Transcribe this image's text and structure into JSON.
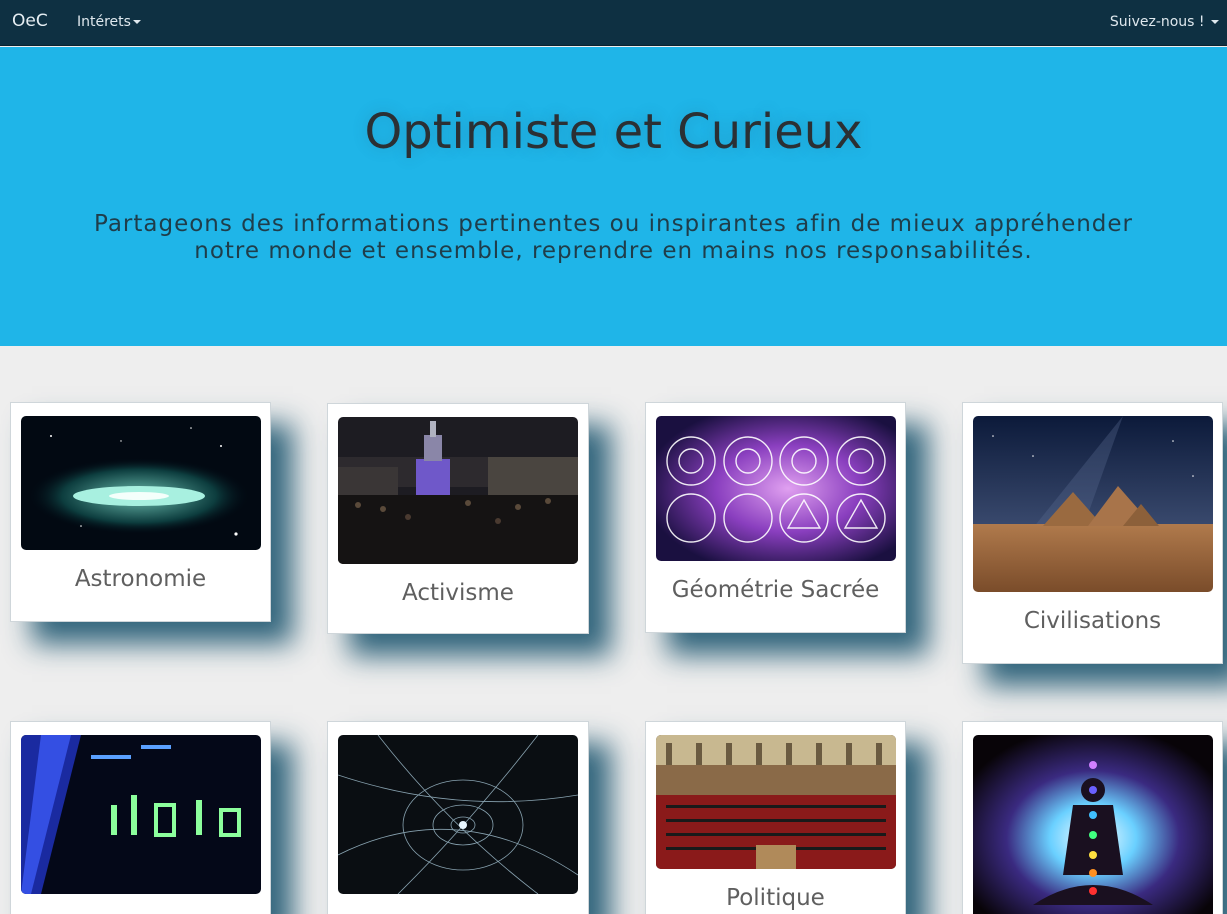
{
  "navbar": {
    "brand": "OeC",
    "menu_interests": "Intérets",
    "menu_follow": "Suivez-nous !"
  },
  "hero": {
    "title": "Optimiste et Curieux",
    "subtitle": "Partageons des informations pertinentes ou inspirantes afin de mieux appréhender notre monde et ensemble, reprendre en mains nos responsabilités."
  },
  "cards": [
    {
      "label": "Astronomie",
      "image": "galaxy"
    },
    {
      "label": "Activisme",
      "image": "night-crowd"
    },
    {
      "label": "Géométrie Sacrée",
      "image": "sacred-geometry"
    },
    {
      "label": "Civilisations",
      "image": "pyramids"
    },
    {
      "label": "",
      "image": "stock-ticker"
    },
    {
      "label": "",
      "image": "quantum-spiral"
    },
    {
      "label": "Politique",
      "image": "parliament"
    },
    {
      "label": "",
      "image": "meditation-chakras"
    }
  ]
}
